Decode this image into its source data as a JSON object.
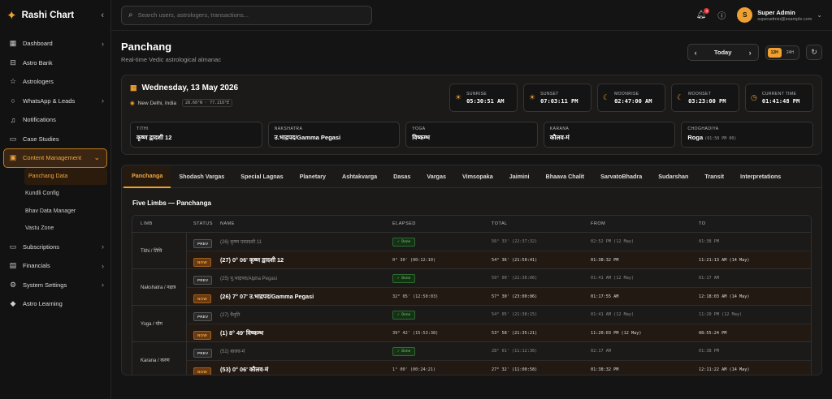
{
  "brand": {
    "name": "Rashi Chart"
  },
  "sidebar": {
    "items": [
      {
        "label": "Dashboard",
        "icon": "grid-icon",
        "chevron": true
      },
      {
        "label": "Astro Bank",
        "icon": "bank-icon",
        "chevron": false
      },
      {
        "label": "Astrologers",
        "icon": "star-icon",
        "chevron": false
      },
      {
        "label": "WhatsApp & Leads",
        "icon": "chat-icon",
        "chevron": true
      },
      {
        "label": "Notifications",
        "icon": "bell-icon",
        "chevron": false
      },
      {
        "label": "Case Studies",
        "icon": "book-icon",
        "chevron": false
      },
      {
        "label": "Content Management",
        "icon": "content-icon",
        "chevron": true,
        "active": true
      }
    ],
    "subitems": [
      {
        "label": "Panchang Data",
        "active": true
      },
      {
        "label": "Kundli Config"
      },
      {
        "label": "Bhav Data Manager"
      },
      {
        "label": "Vastu Zone"
      }
    ],
    "items_bottom": [
      {
        "label": "Subscriptions",
        "icon": "card-icon",
        "chevron": true
      },
      {
        "label": "Financials",
        "icon": "ledger-icon",
        "chevron": true
      },
      {
        "label": "System Settings",
        "icon": "gear-icon",
        "chevron": true
      },
      {
        "label": "Astro Learning",
        "icon": "grad-icon",
        "chevron": false
      }
    ]
  },
  "topbar": {
    "search_placeholder": "Search users, astrologers, transactions...",
    "notification_count": "3",
    "user": {
      "initial": "S",
      "name": "Super Admin",
      "email": "superadmin@example.com"
    }
  },
  "page": {
    "title": "Panchang",
    "subtitle": "Real-time Vedic astrological almanac",
    "today_label": "Today",
    "toggle_12": "12H",
    "toggle_24": "24H"
  },
  "day": {
    "date": "Wednesday, 13 May 2026",
    "location": "New Delhi, India",
    "coords": "28.66°N · 77.216°E",
    "times": [
      {
        "label": "SUNRISE",
        "value": "05:30:51 AM",
        "icon": "sunrise-icon"
      },
      {
        "label": "SUNSET",
        "value": "07:03:11 PM",
        "icon": "sunset-icon"
      },
      {
        "label": "MOONRISE",
        "value": "02:47:00 AM",
        "icon": "moonrise-icon"
      },
      {
        "label": "MOONSET",
        "value": "03:23:00 PM",
        "icon": "moonset-icon"
      },
      {
        "label": "CURRENT TIME",
        "value": "01:41:48 PM",
        "icon": "clock-icon"
      }
    ],
    "limbs": [
      {
        "label": "TITHI",
        "value": "कृष्ण द्वादशी 12",
        "note": ""
      },
      {
        "label": "NAKSHATRA",
        "value": "उ.भाद्रपद/Gamma Pegasi",
        "note": ""
      },
      {
        "label": "YOGA",
        "value": "विष्कम्भ",
        "note": ""
      },
      {
        "label": "KARANA",
        "value": "कौलव-मं",
        "note": ""
      },
      {
        "label": "CHOGHADIYA",
        "value": "Roga",
        "note": "(01:58 PM 00)"
      }
    ]
  },
  "tabs": [
    "Panchanga",
    "Shodash Vargas",
    "Special Lagnas",
    "Planetary",
    "Ashtakvarga",
    "Dasas",
    "Vargas",
    "Vimsopaka",
    "Jaimini",
    "Bhaava Chalit",
    "SarvatoBhadra",
    "Sudarshan",
    "Transit",
    "Interpretations"
  ],
  "section_title": "Five Limbs — Panchanga",
  "table": {
    "headers": [
      "LIMB",
      "STATUS",
      "NAME",
      "ELAPSED",
      "TOTAL",
      "FROM",
      "TO"
    ],
    "groups": [
      {
        "limb": "Tithi / तिथि",
        "rows": [
          {
            "status": "PREV",
            "name": "(26) कृष्ण एकादशी 11",
            "elapsed": "Done",
            "total": "56° 33' (22:37:32)",
            "from": "02:52 PM (12 May)",
            "to": "01:38 PM"
          },
          {
            "status": "NOW",
            "name": "(27) 0° 06' कृष्ण द्वादशी 12",
            "elapsed": "0° 30' (00:12:10)",
            "total": "54° 36' (21:50:41)",
            "from": "01:38:32 PM",
            "to": "11:21:13 AM (14 May)"
          }
        ]
      },
      {
        "limb": "Nakshatra / नक्षत्र",
        "rows": [
          {
            "status": "PREV",
            "name": "(25) पू.भाद्रपद/Alpha Pegasi",
            "elapsed": "Done",
            "total": "59° 00' (21:36:06)",
            "from": "01:41 AM (12 May)",
            "to": "01:17 AM"
          },
          {
            "status": "NOW",
            "name": "(26) 7° 07' उ.भाद्रपद/Gamma Pegasi",
            "elapsed": "32° 05' (12:50:03)",
            "total": "57° 30' (23:00:06)",
            "from": "01:17:55 AM",
            "to": "12:18:03 AM (14 May)"
          }
        ]
      },
      {
        "limb": "Yoga / योग",
        "rows": [
          {
            "status": "PREV",
            "name": "(27) वैधृति",
            "elapsed": "Done",
            "total": "54° 05' (21:38:15)",
            "from": "01:41 AM (12 May)",
            "to": "11:20 PM (12 May)"
          },
          {
            "status": "NOW",
            "name": "(1) 8° 49' विष्कम्भ",
            "elapsed": "39° 42' (15:53:38)",
            "total": "53° 58' (21:35:21)",
            "from": "11:20:03 PM (12 May)",
            "to": "08:55:24 PM"
          }
        ]
      },
      {
        "limb": "Karana / करण",
        "rows": [
          {
            "status": "PREV",
            "name": "(52) बालव-मं",
            "elapsed": "Done",
            "total": "28° 01' (11:12:36)",
            "from": "02:17 AM",
            "to": "01:38 PM"
          },
          {
            "status": "NOW",
            "name": "(53) 0° 06' कौलव-मं",
            "elapsed": "1° 00' (00:24:21)",
            "total": "27° 32' (11:00:58)",
            "from": "01:38:32 PM",
            "to": "12:11:22 AM (14 May)"
          }
        ]
      }
    ]
  },
  "colors": {
    "accent": "#f0a030",
    "background": "#141414",
    "card": "#1b1a19",
    "done": "#6ed36e"
  }
}
